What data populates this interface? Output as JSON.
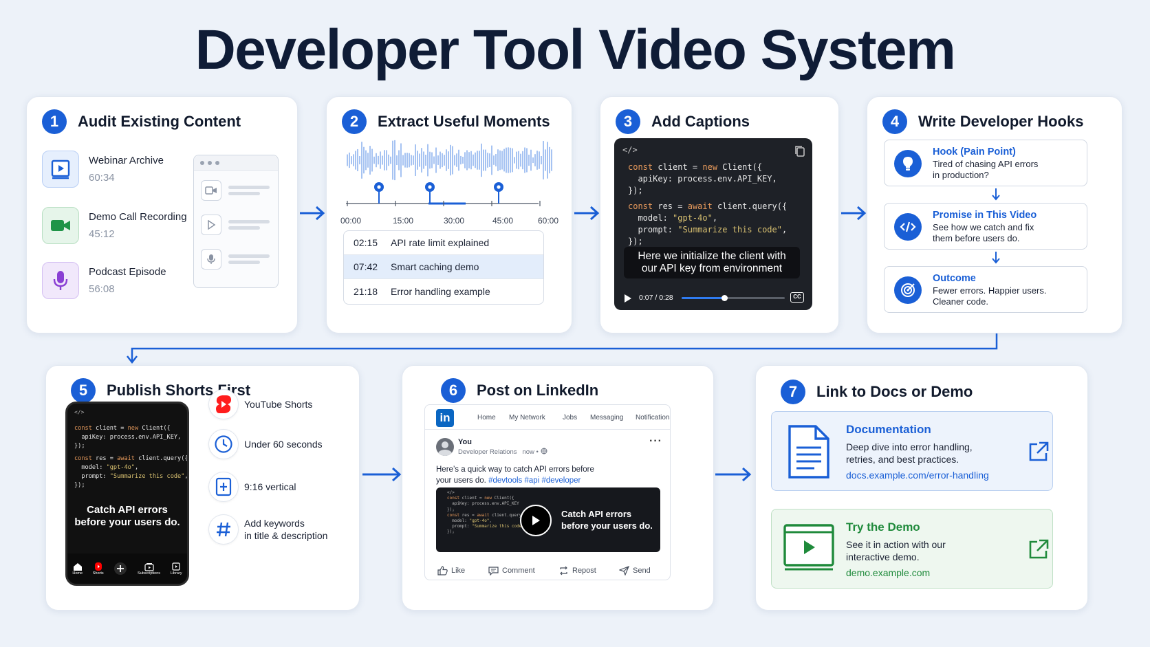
{
  "title": "Developer Tool Video System",
  "colors": {
    "accent": "#1a5fd6",
    "background": "#edf2f9",
    "card": "#ffffff",
    "green_accent": "#1f8a3b"
  },
  "steps": [
    {
      "num": "1",
      "title": "Audit Existing Content",
      "sources": [
        {
          "name": "Webinar Archive",
          "duration": "60:34",
          "icon": "video-play-icon"
        },
        {
          "name": "Demo Call Recording",
          "duration": "45:12",
          "icon": "video-camera-icon"
        },
        {
          "name": "Podcast Episode",
          "duration": "56:08",
          "icon": "microphone-icon"
        }
      ]
    },
    {
      "num": "2",
      "title": "Extract Useful Moments",
      "timeline_ticks": [
        "00:00",
        "15:00",
        "30:00",
        "45:00",
        "60:00"
      ],
      "moments": [
        {
          "time": "02:15",
          "label": "API rate limit explained"
        },
        {
          "time": "07:42",
          "label": "Smart caching demo"
        },
        {
          "time": "21:18",
          "label": "Error handling example"
        }
      ]
    },
    {
      "num": "3",
      "title": "Add Captions",
      "code_icon": "</>",
      "code": {
        "l1_kw": "const",
        "l1_a": " client = ",
        "l1_kw2": "new",
        "l1_b": " Client({",
        "l2": "  apiKey: process.env.API_KEY,",
        "l3": "});",
        "l4_kw": "const",
        "l4_a": " res = ",
        "l4_kw2": "await",
        "l4_b": " client.query({",
        "l5_a": "  model: ",
        "l5_s": "\"gpt-4o\"",
        "l5_b": ",",
        "l6_a": "  prompt: ",
        "l6_s": "\"Summarize this code\"",
        "l6_b": ",",
        "l7": "});"
      },
      "caption_line1": "Here we initialize the client with",
      "caption_line2": "our API key from environment",
      "player_time": "0:07 / 0:28",
      "progress": 0.41,
      "cc_label": "CC"
    },
    {
      "num": "4",
      "title": "Write Developer Hooks",
      "hooks": [
        {
          "title": "Hook (Pain Point)",
          "desc1": "Tired of chasing API errors",
          "desc2": "in production?",
          "icon": "lightbulb-icon"
        },
        {
          "title": "Promise in This Video",
          "desc1": "See how we catch and fix",
          "desc2": "them before users do.",
          "icon": "code-icon"
        },
        {
          "title": "Outcome",
          "desc1": "Fewer errors. Happier users.",
          "desc2": "Cleaner code.",
          "icon": "target-icon"
        }
      ]
    },
    {
      "num": "5",
      "title": "Publish Shorts First",
      "phone_caption1": "Catch API errors",
      "phone_caption2": "before your users do.",
      "phone_nav": [
        "Home",
        "Shorts",
        "",
        "Subscriptions",
        "Library"
      ],
      "features": [
        {
          "line1": "YouTube Shorts",
          "line2": "",
          "icon": "youtube-shorts-icon"
        },
        {
          "line1": "Under 60 seconds",
          "line2": "",
          "icon": "clock-icon"
        },
        {
          "line1": "9:16 vertical",
          "line2": "",
          "icon": "vertical-frame-icon"
        },
        {
          "line1": "Add keywords",
          "line2": "in title & description",
          "icon": "hashtag-icon"
        }
      ]
    },
    {
      "num": "6",
      "title": "Post on LinkedIn",
      "nav": [
        "Home",
        "My Network",
        "Jobs",
        "Messaging",
        "Notifications"
      ],
      "user": "You",
      "user_title": "Developer Relations",
      "post_meta": "now •",
      "post_text": "Here’s a quick way to catch API errors before",
      "post_text2": "your users do.",
      "hashtags": "#devtools #api #developer",
      "video_caption1": "Catch API errors",
      "video_caption2": "before your users do.",
      "actions": [
        "Like",
        "Comment",
        "Repost",
        "Send"
      ]
    },
    {
      "num": "7",
      "title": "Link to Docs or Demo",
      "links": [
        {
          "title": "Documentation",
          "desc1": "Deep dive into error handling,",
          "desc2": "retries, and best practices.",
          "url": "docs.example.com/error-handling"
        },
        {
          "title": "Try the Demo",
          "desc1": "See it in action with our",
          "desc2": "interactive demo.",
          "url": "demo.example.com"
        }
      ]
    }
  ]
}
